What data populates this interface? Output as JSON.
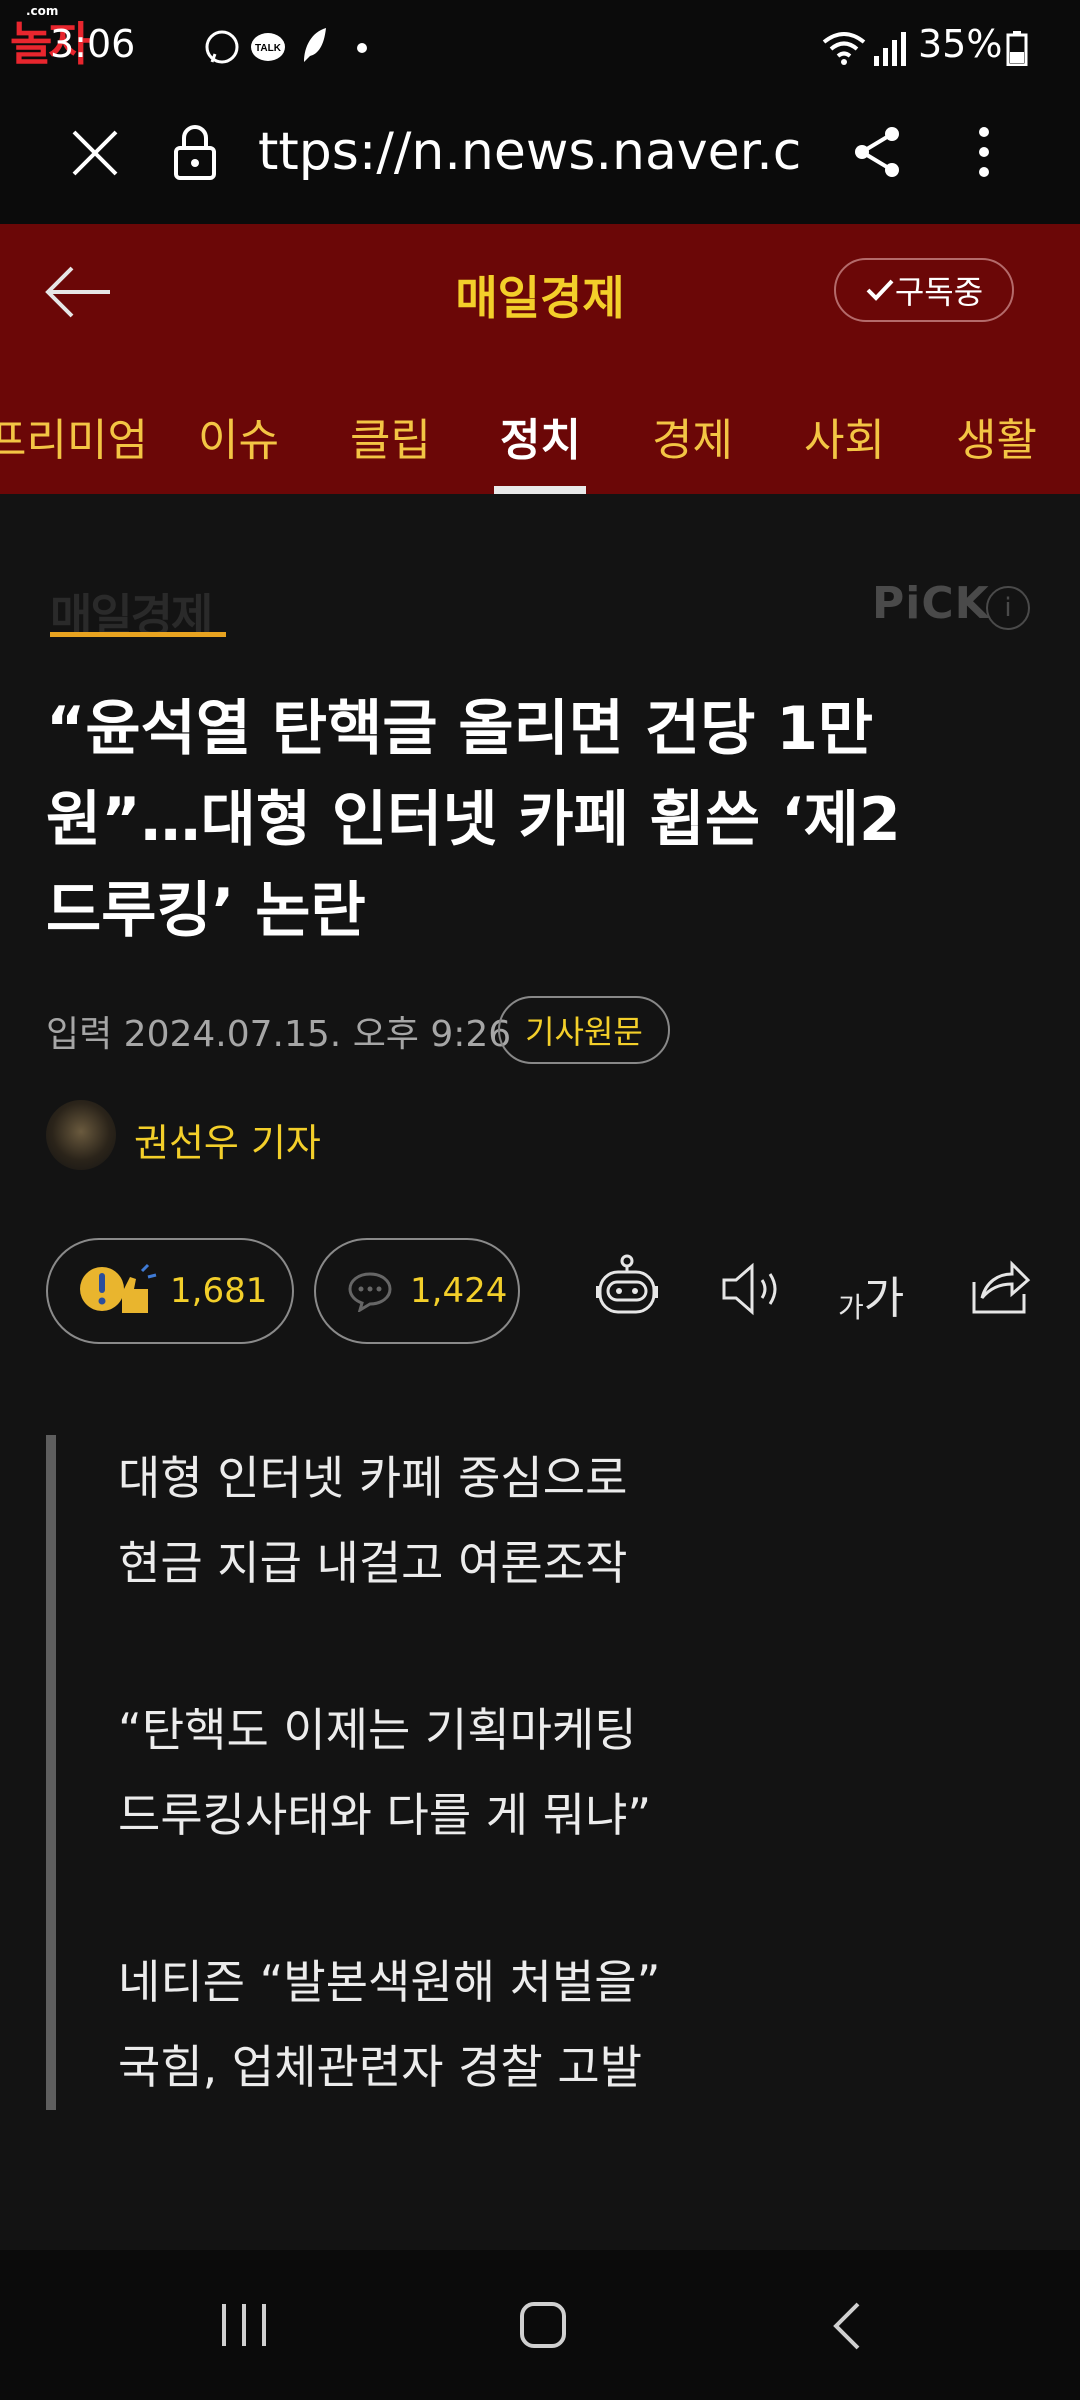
{
  "status_bar": {
    "watermark": "놀자",
    "watermark_tag": ".com",
    "time": "3:06",
    "battery": "35%"
  },
  "browser": {
    "url": "ttps://n.news.naver.com/a"
  },
  "press": {
    "name": "매일경제",
    "subscribe_label": "구독중"
  },
  "tabs": [
    {
      "label": "프리미엄",
      "active": false
    },
    {
      "label": "이슈",
      "active": false
    },
    {
      "label": "클립",
      "active": false
    },
    {
      "label": "정치",
      "active": true
    },
    {
      "label": "경제",
      "active": false
    },
    {
      "label": "사회",
      "active": false
    },
    {
      "label": "생활",
      "active": false
    }
  ],
  "article": {
    "press_logo": "매일경제",
    "pick": "PiCK",
    "pick_info": "i",
    "headline_lines": [
      "“윤석열 탄핵글 올리면 건당 1만",
      "원”…대형 인터넷 카페 휩쓴 ‘제2",
      "드루킹’ 논란"
    ],
    "date": "입력 2024.07.15. 오후 9:26",
    "original_label": "기사원문",
    "reporter": "권선우 기자",
    "like_count": "1,681",
    "comment_count": "1,424",
    "font_size_small": "가",
    "font_size_large": "가",
    "summary_lines": [
      "대형 인터넷 카페 중심으로",
      "현금 지급 내걸고 여론조작",
      "“탄핵도 이제는 기획마케팅",
      "드루킹사태와 다를 게 뭐냐”",
      "네티즌 “발본색원해 처벌을”",
      "국힘, 업체관련자 경찰 고발"
    ]
  },
  "colors": {
    "header_bg": "#6b0707",
    "accent_yellow": "#f3cf2a",
    "page_bg": "#131313"
  }
}
